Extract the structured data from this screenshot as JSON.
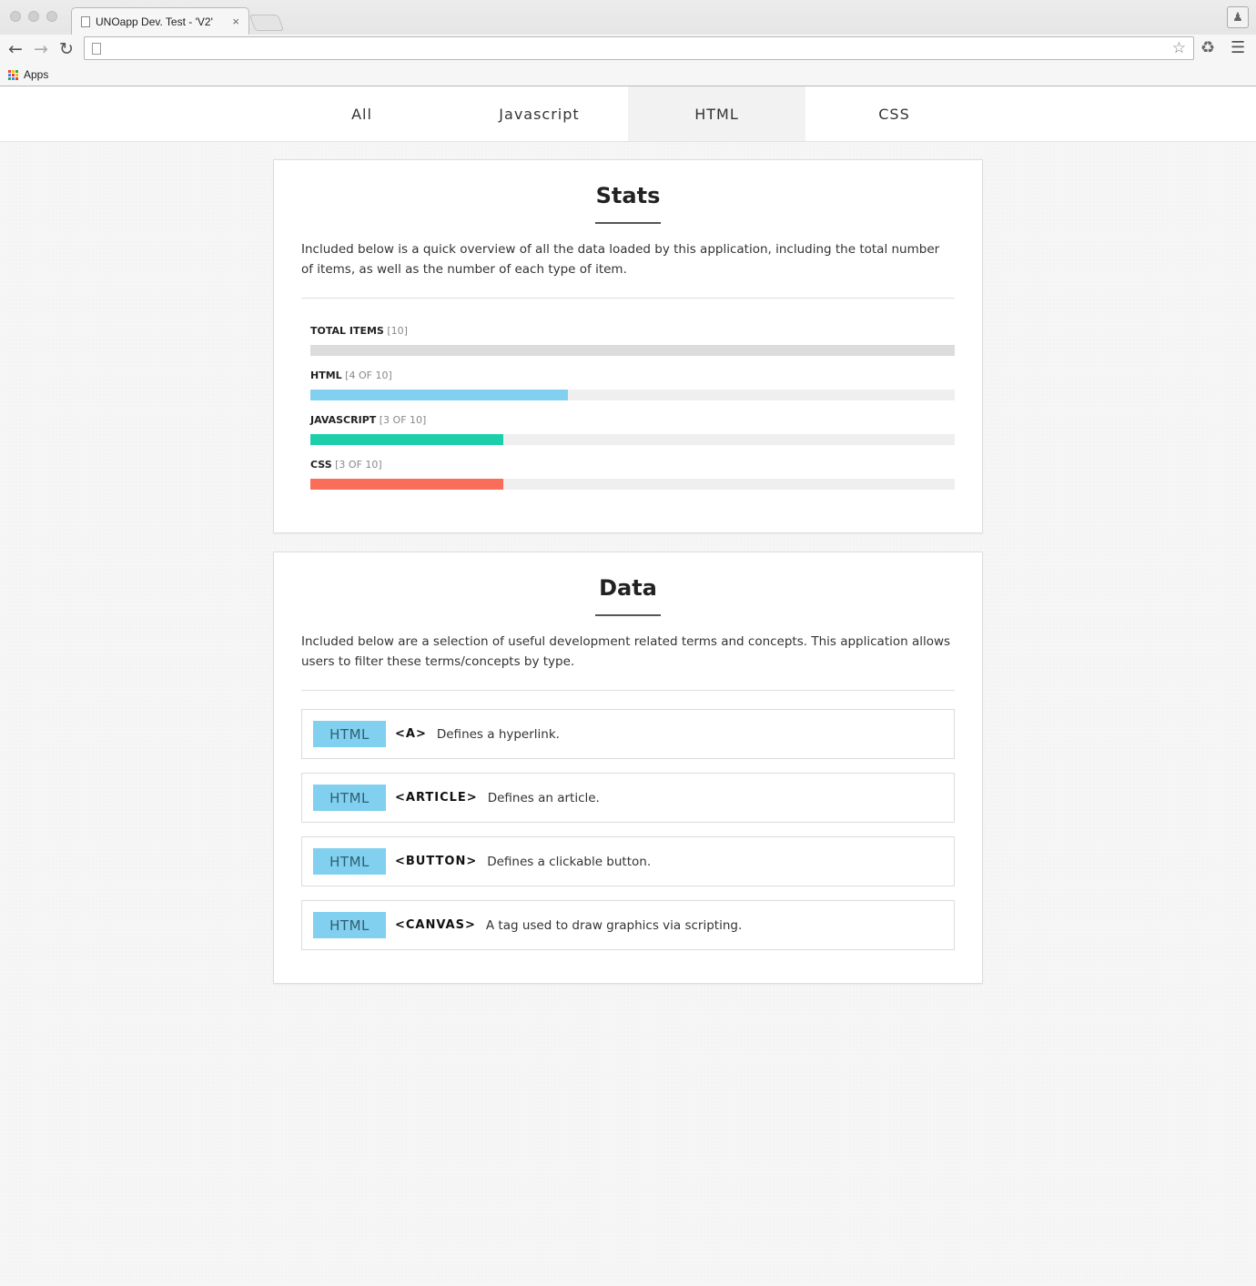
{
  "browser": {
    "tab_title": "UNOapp Dev. Test - 'V2'",
    "tab_close": "×",
    "address_value": "",
    "bookmark_apps": "Apps",
    "apps_colors": [
      "#e94235",
      "#fbbc05",
      "#34a853",
      "#4285f4",
      "#e94235",
      "#fbbc05",
      "#34a853",
      "#4285f4",
      "#e94235"
    ]
  },
  "filters": {
    "active": "HTML",
    "tabs": [
      {
        "label": "All"
      },
      {
        "label": "Javascript"
      },
      {
        "label": "HTML"
      },
      {
        "label": "CSS"
      }
    ]
  },
  "stats": {
    "title": "Stats",
    "intro": "Included below is a quick overview of all the data loaded by this application, including the total number of items, as well as the number of each type of item.",
    "total": 10,
    "items": [
      {
        "label": "TOTAL ITEMS",
        "count_text": "[10]",
        "fraction": 1.0,
        "color": "#dcdcdc"
      },
      {
        "label": "HTML",
        "count_text": "[4 OF 10]",
        "fraction": 0.4,
        "color": "#81d0ef"
      },
      {
        "label": "JAVASCRIPT",
        "count_text": "[3 OF 10]",
        "fraction": 0.3,
        "color": "#1ccfaa"
      },
      {
        "label": "CSS",
        "count_text": "[3 OF 10]",
        "fraction": 0.3,
        "color": "#f96d59"
      }
    ]
  },
  "data": {
    "title": "Data",
    "intro": "Included below are a selection of useful development related terms and concepts. This application allows users to filter these terms/concepts by type.",
    "badge_color": "#81d0ef",
    "items": [
      {
        "type": "HTML",
        "tag": "<A>",
        "description": "Defines a hyperlink."
      },
      {
        "type": "HTML",
        "tag": "<ARTICLE>",
        "description": "Defines an article."
      },
      {
        "type": "HTML",
        "tag": "<BUTTON>",
        "description": "Defines a clickable button."
      },
      {
        "type": "HTML",
        "tag": "<CANVAS>",
        "description": "A tag used to draw graphics via scripting."
      }
    ]
  }
}
